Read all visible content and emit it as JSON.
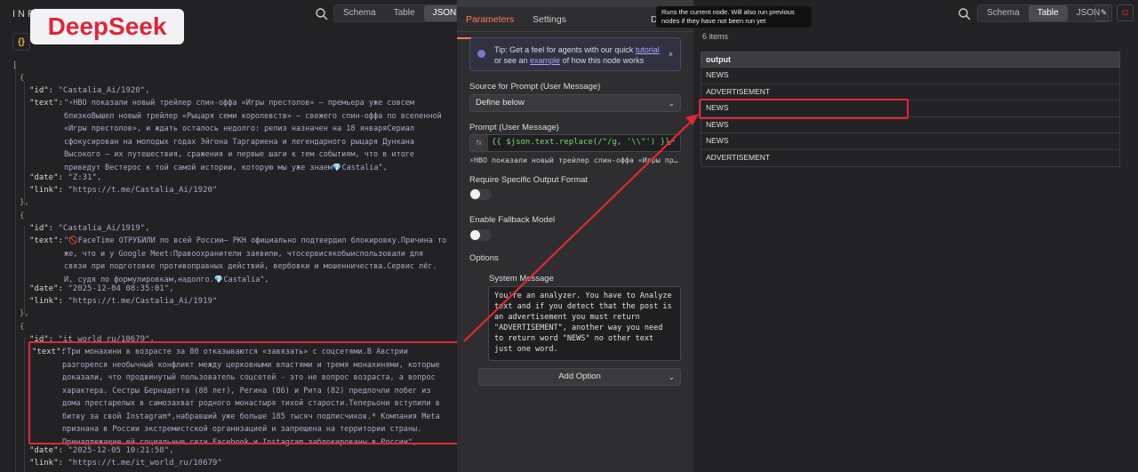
{
  "input_panel": {
    "title": "INP",
    "logo_text": "DeepSeek",
    "view_tabs": [
      "Schema",
      "Table",
      "JSON"
    ],
    "active_tab": "JSON",
    "open_bracket": "[",
    "records": [
      {
        "id_key": "\"id\":",
        "id_value": "\"Castalia_Ai/1920\",",
        "text_key": "\"text\":",
        "text_value": "\"⚡HBO показали новый трейлер спин-оффа «Игры престолов» – премьера уже совсем близкоВышел новый трейлер «Рыцаря семи королевств» – свежего спин-оффа по вселенной «Игры престолов», и ждать осталось недолго: релиз назначен на 18 январяСериал сфокусирован на молодых годах Эйгона Таргариена и легендарного рыцаря Дункана Высокого – их путешествия, сражения и первые шаги к тем событиям, что в итоге приведут Вестерос к той самой истории, которую мы уже знаем💎Castalia\",",
        "date_key": "\"date\":",
        "date_value": "\"Z:31\",",
        "link_key": "\"link\":",
        "link_value": "\"https://t.me/Castalia_Ai/1920\""
      },
      {
        "id_key": "\"id\":",
        "id_value": "\"Castalia_Ai/1919\",",
        "text_key": "\"text\":",
        "text_value": "\"🚫FaceTime ОТРУБИЛИ по всей России– РКН официально подтвердил блокировку.Причина то же, что и у Google Meet:Правоохранители заявили, чтосервисякобыиспользовали для связи при подготовке противоправных действий, вербовки и мошенничества.Сервис лёг. И, судя по формулировкам,надолго.💎Castalia\",",
        "date_key": "\"date\":",
        "date_value": "\"2025-12-04 08:35:01\",",
        "link_key": "\"link\":",
        "link_value": "\"https://t.me/Castalia_Ai/1919\""
      },
      {
        "id_key": "\"id\":",
        "id_value": "\"it_world_ru/10679\",",
        "text_key": "\"text\":",
        "text_value": "\"Три монахини в возрасте за 80 отказываются «завязать» с соцсетями.В Австрии разгорелся необычный конфликт между церковными властями и тремя монахинями, которые доказали, что продвинутый пользователь соцсетей - это не вопрос возраста, а вопрос характера. Сестры Бернадетта (88 лет), Регина (86) и Рита (82) предпочли побег из дома престарелых в самозахват родного монастыря тихой старости.Теперьони вступили в битву за свой Instagram*,набравший уже больше 185 тысяч подписчиков.* Компания Meta признана в России экстремистской организацией и запрещена на территории страны. Принадлежащие ей социальные сети Facebook и Instagram заблокированы в России\",",
        "date_key": "\"date\":",
        "date_value": "\"2025-12-05 10:21:58\",",
        "link_key": "\"link\":",
        "link_value": "\"https://t.me/it_world_ru/10679\""
      }
    ],
    "brace_open": "{",
    "brace_close": "},"
  },
  "node_panel": {
    "tabs": [
      "Parameters",
      "Settings",
      "Do"
    ],
    "active_tab": "Parameters",
    "tip": {
      "prefix": "Tip: Get a feel for agents with our quick ",
      "link1": "tutorial",
      "middle": " or see an ",
      "link2": "example",
      "suffix": " of how this node works"
    },
    "source_label": "Source for Prompt (User Message)",
    "source_value": "Define below",
    "prompt_label": "Prompt (User Message)",
    "prompt_expression": "{{ $json.text.replace(/\"/g, '\\\\\"') }}",
    "prompt_preview": "⚡HBO показали новый трейлер спин-оффа «Игры пр…",
    "output_format_label": "Require Specific Output Format",
    "output_format_enabled": false,
    "fallback_label": "Enable Fallback Model",
    "fallback_enabled": false,
    "options_label": "Options",
    "system_message_label": "System Message",
    "system_message": "You're an analyzer. You have to Analyze text and if you detect that the post is an advertisement you must return \"ADVERTISEMENT\", another way you need to return word \"NEWS\" no other text just one word.",
    "add_option_label": "Add Option"
  },
  "tooltip": {
    "text": "Runs the current node. Will also run previous nodes if they have not been run yet"
  },
  "output_panel": {
    "view_tabs": [
      "Schema",
      "Table",
      "JSON"
    ],
    "active_tab": "Table",
    "items_count": "6 items",
    "column_header": "output",
    "rows": [
      "NEWS",
      "ADVERTISEMENT",
      "NEWS",
      "NEWS",
      "NEWS",
      "ADVERTISEMENT"
    ],
    "highlighted_row": 2
  },
  "colors": {
    "annotation_red": "#e2263a",
    "accent_orange": "#ff7a55"
  }
}
